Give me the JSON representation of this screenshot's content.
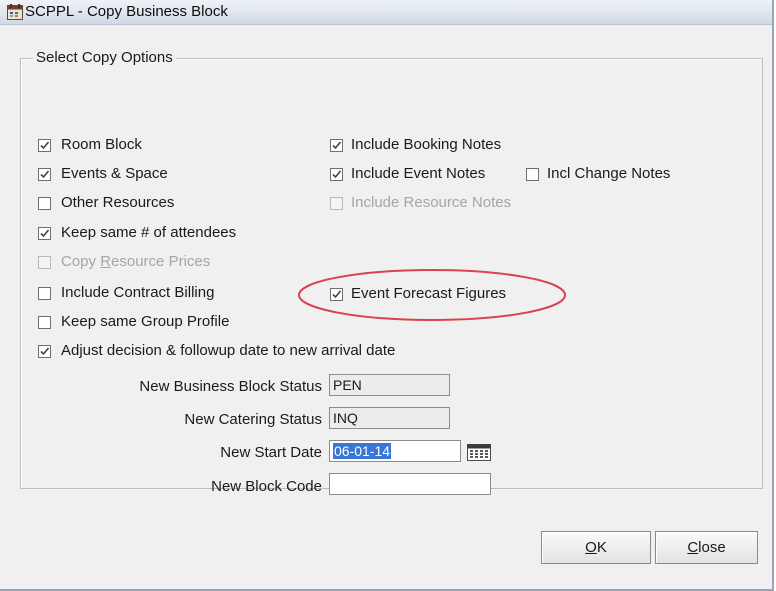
{
  "window": {
    "title": "SCPPL - Copy Business Block",
    "icon": "calendar-app-icon"
  },
  "groupbox": {
    "legend": "Select Copy Options"
  },
  "left_options": [
    {
      "key": "room_block",
      "label": "Room Block",
      "checked": true,
      "enabled": true
    },
    {
      "key": "events_space",
      "label": "Events & Space",
      "checked": true,
      "enabled": true
    },
    {
      "key": "other_resources",
      "label": "Other Resources",
      "checked": false,
      "enabled": true
    },
    {
      "key": "keep_attendees",
      "label": "Keep same # of attendees",
      "checked": true,
      "enabled": true
    },
    {
      "key": "copy_resource_prices",
      "label_prefix": "Copy ",
      "label_mnemonic": "R",
      "label_suffix": "esource Prices",
      "checked": false,
      "enabled": false
    },
    {
      "key": "include_contract_billing",
      "label": "Include Contract Billing",
      "checked": false,
      "enabled": true
    },
    {
      "key": "keep_group_profile",
      "label": "Keep same Group Profile",
      "checked": false,
      "enabled": true
    },
    {
      "key": "adjust_decision",
      "label": "Adjust decision & followup date to new arrival date",
      "checked": true,
      "enabled": true
    }
  ],
  "right_options": [
    {
      "key": "include_booking_notes",
      "label": "Include Booking Notes",
      "checked": true,
      "enabled": true
    },
    {
      "key": "include_event_notes",
      "label": "Include Event Notes",
      "checked": true,
      "enabled": true
    },
    {
      "key": "incl_change_notes",
      "label": "Incl Change Notes",
      "checked": false,
      "enabled": true
    },
    {
      "key": "include_resource_notes",
      "label": "Include Resource Notes",
      "checked": false,
      "enabled": false
    },
    {
      "key": "event_forecast_figures",
      "label": "Event Forecast Figures",
      "checked": true,
      "enabled": true
    }
  ],
  "fields": {
    "business_block_status": {
      "label": "New Business Block Status",
      "value": "PEN"
    },
    "catering_status": {
      "label": "New Catering Status",
      "value": "INQ"
    },
    "start_date": {
      "label": "New Start Date",
      "value": "06-01-14"
    },
    "block_code": {
      "label": "New Block Code",
      "value": ""
    }
  },
  "buttons": {
    "ok": {
      "mnemonic": "O",
      "rest": "K"
    },
    "close": {
      "mnemonic": "C",
      "rest": "lose"
    }
  },
  "annotation": {
    "shape": "ellipse",
    "color": "#d9434c",
    "target": "event_forecast_figures"
  }
}
